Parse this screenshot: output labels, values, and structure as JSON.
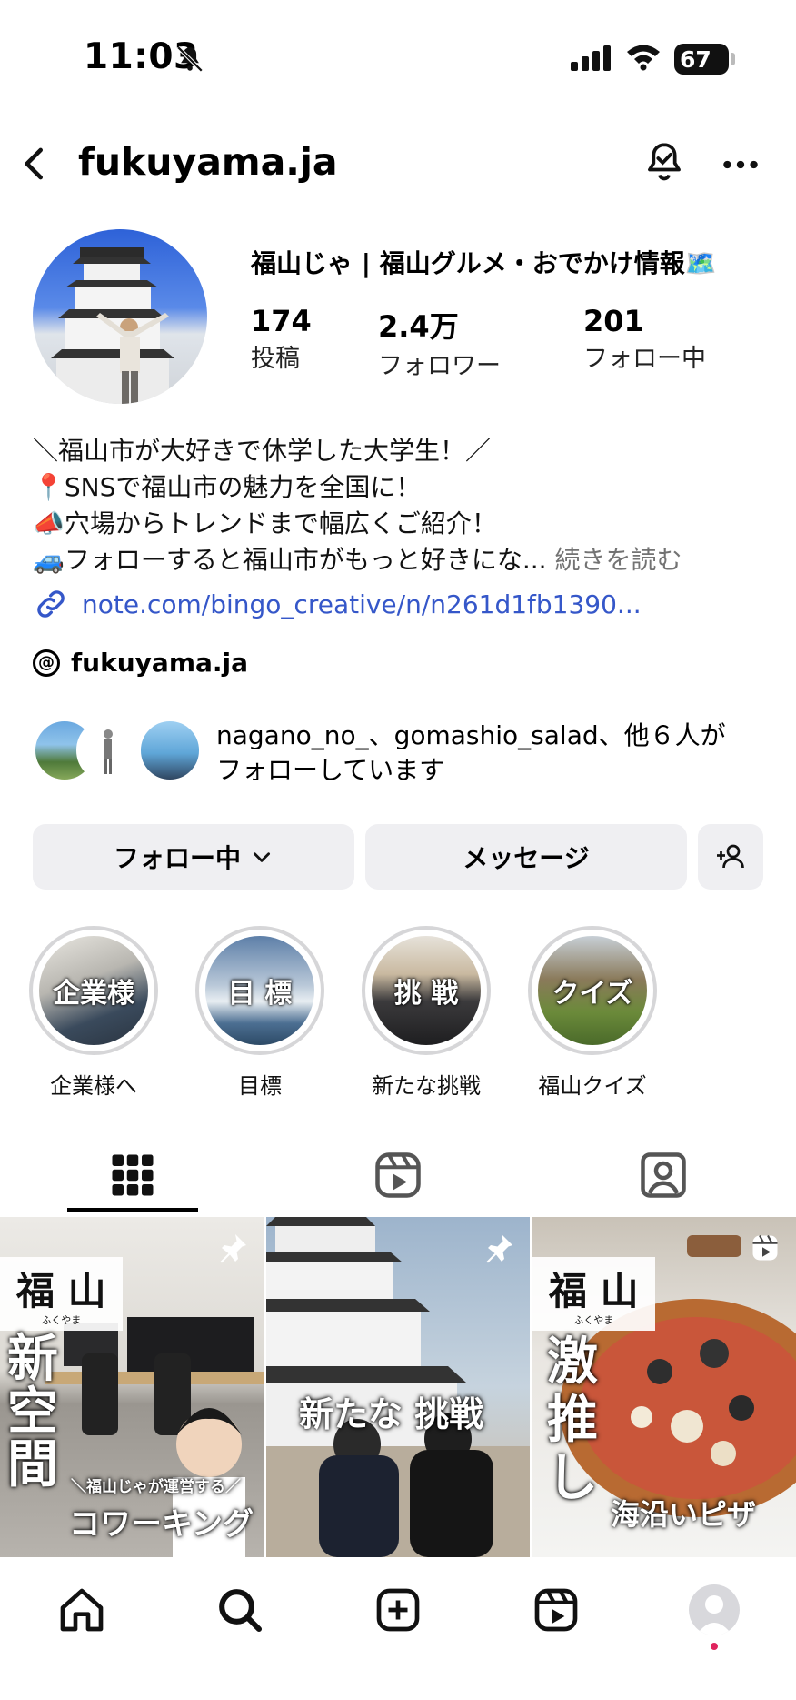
{
  "status_bar": {
    "time": "11:03",
    "battery": "67"
  },
  "header": {
    "username": "fukuyama.ja"
  },
  "profile": {
    "full_name": "福山じゃ | 福山グルメ・おでかけ情報🗺️",
    "stats": [
      {
        "value": "174",
        "label": "投稿"
      },
      {
        "value": "2.4万",
        "label": "フォロワー"
      },
      {
        "value": "201",
        "label": "フォロー中"
      }
    ],
    "bio_lines": [
      "＼福山市が大好きで休学した大学生！／",
      "📍SNSで福山市の魅力を全国に！",
      "📣穴場からトレンドまで幅広くご紹介！",
      "🚙フォローすると福山市がもっと好きにな..."
    ],
    "bio_more": "続きを読む",
    "link": "note.com/bingo_creative/n/n261d1fb1390...",
    "threads_handle": "fukuyama.ja",
    "mutual_line1": "nagano_no_、gomashio_salad、他６人が",
    "mutual_line2": "フォローしています"
  },
  "buttons": {
    "following": "フォロー中",
    "message": "メッセージ"
  },
  "highlights": [
    {
      "cover_text": "企業様",
      "label": "企業様へ"
    },
    {
      "cover_text": "目 標",
      "label": "目標"
    },
    {
      "cover_text": "挑 戦",
      "label": "新たな挑戦"
    },
    {
      "cover_text": "クイズ",
      "label": "福山クイズ"
    }
  ],
  "tabs": [
    "grid-icon",
    "reels-icon",
    "tagged-icon"
  ],
  "posts": [
    {
      "ribbon": "福 山",
      "ribbon_sub": "ふくやま",
      "big": "新\n空\n間",
      "caption_top": "＼福山じゃが運営する／",
      "caption": "コワーキング"
    },
    {
      "big": "新たな 挑戦"
    },
    {
      "ribbon": "福 山",
      "ribbon_sub": "ふくやま",
      "big": "激\n推\nし",
      "caption": "海沿いピザ"
    }
  ],
  "nav": [
    "home-icon",
    "search-icon",
    "create-icon",
    "reels-icon",
    "profile-icon"
  ],
  "colors": {
    "link": "#3557c9",
    "button_bg": "#efeff2",
    "notification_dot": "#e0245e"
  }
}
